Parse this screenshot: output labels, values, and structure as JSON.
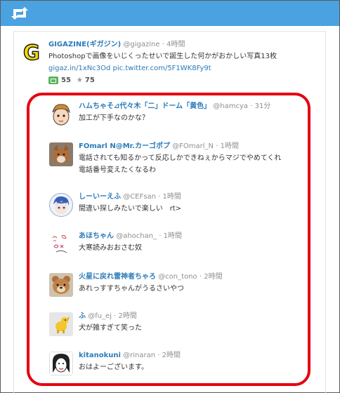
{
  "colors": {
    "accent": "#4aa3e0",
    "link": "#2b7bb9",
    "highlight": "#e60012",
    "retweet": "#5ab55d"
  },
  "topbar": {
    "icon": "retweet-icon"
  },
  "main_tweet": {
    "logo": "gigazine-logo",
    "name": "GIGAZINE(ギガジン)",
    "handle": "@gigazine",
    "time": "4時間",
    "text": "Photoshopで画像をいじくったせいで誕生した何かがおかしい写真13枚",
    "link_text": "gigaz.in/1xNc3Od",
    "pic_text": "pic.twitter.com/5F1WK8Fy9t",
    "retweets": "55",
    "favorites": "75"
  },
  "replies": [
    {
      "avatar": "anime-face-avatar",
      "name": "ハムちゃそ⊿代々木「二」ドーム「黄色」",
      "handle": "@hamcya",
      "time": "31分",
      "lines": [
        "加工が下手なのかな？"
      ]
    },
    {
      "avatar": "fox-photo-avatar",
      "name": "FOmarl N@Mr.カーゴポプ",
      "handle": "@FOmarl_N",
      "time": "1時間",
      "lines": [
        "電話されても知るかって反応しかできねぇからマジでやめてくれ",
        "電話番号変えたくなるわ"
      ]
    },
    {
      "avatar": "blue-hair-avatar",
      "name": "しーいーえふ",
      "handle": "@CEFsan",
      "time": "1時間",
      "lines": [
        "間違い探しみたいで楽しい　rt>"
      ]
    },
    {
      "avatar": "drawing-avatar",
      "name": "あほちゃん",
      "handle": "@ahochan_",
      "time": "1時間",
      "lines": [
        "大寒読みおおさむ奴"
      ]
    },
    {
      "avatar": "bear-photo-avatar",
      "name": "火星に戻れ雷神者ちゃろ",
      "handle": "@con_tono",
      "time": "2時間",
      "lines": [
        "あれっすすちゃんがうるさいやつ"
      ]
    },
    {
      "avatar": "dog-toy-avatar",
      "name": "ふ",
      "handle": "@fu_ej",
      "time": "2時間",
      "lines": [
        "犬が雑すぎて笑った"
      ]
    },
    {
      "avatar": "sketch-face-avatar",
      "name": "kitanokuni",
      "handle": "@rinaran",
      "time": "2時間",
      "lines": [
        "おはよーございます。"
      ]
    }
  ]
}
